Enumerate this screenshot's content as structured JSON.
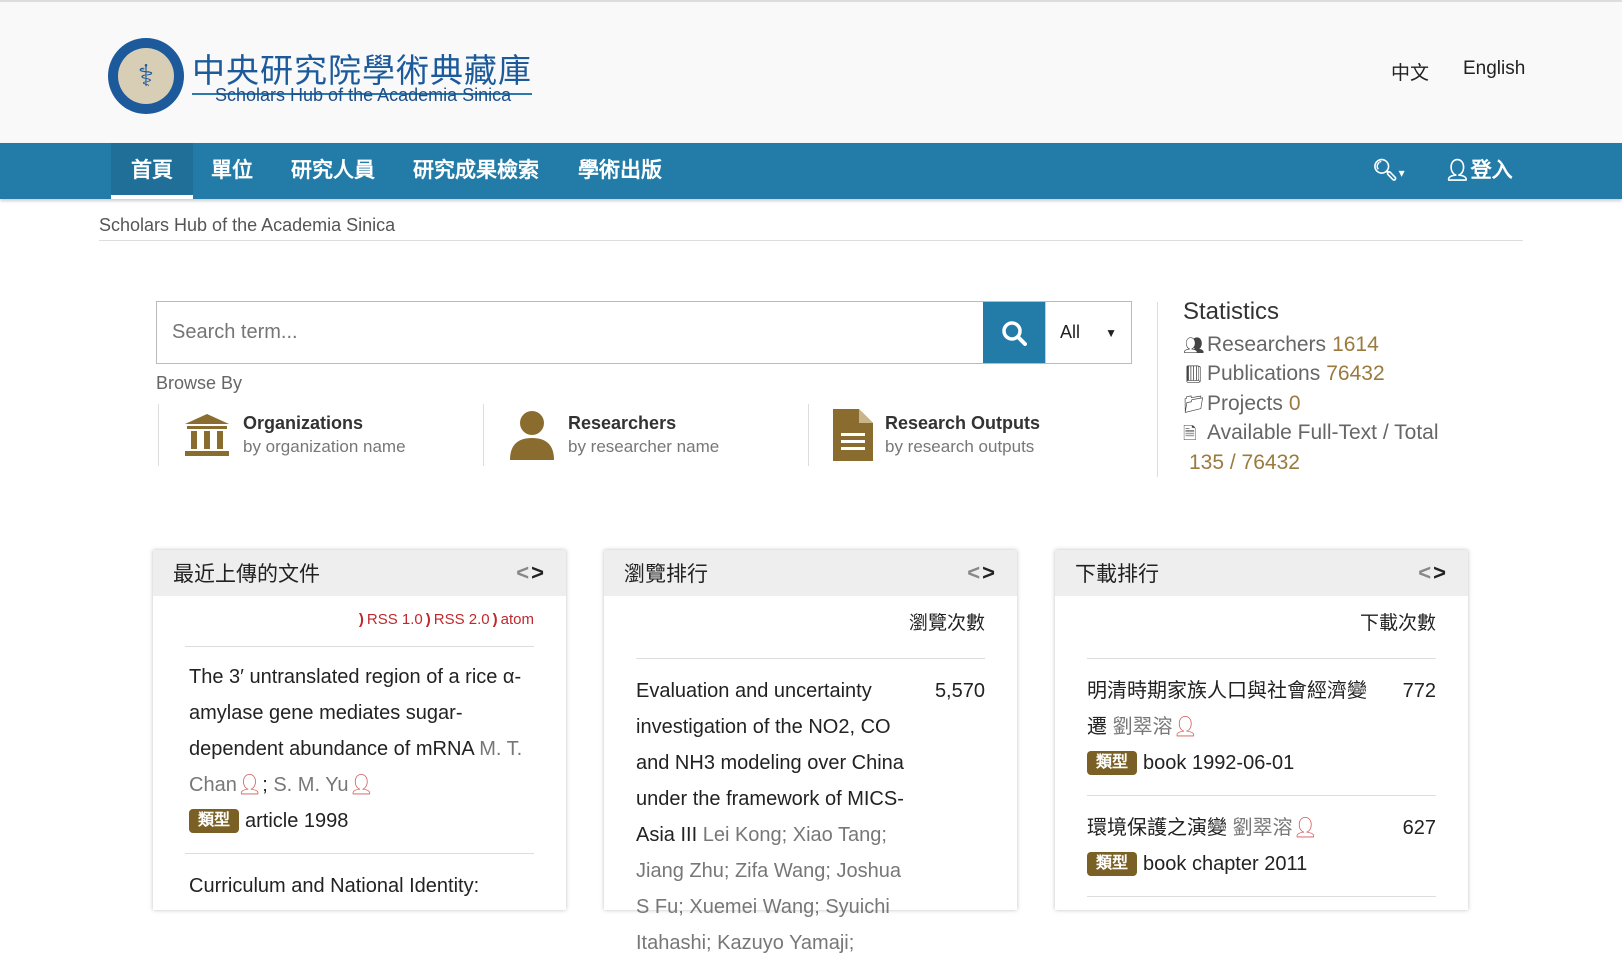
{
  "header": {
    "logo_zh": "中央研究院學術典藏庫",
    "logo_en": "Scholars Hub of the Academia Sinica",
    "lang_zh": "中文",
    "lang_en": "English"
  },
  "nav": {
    "items": [
      "首頁",
      "單位",
      "研究人員",
      "研究成果檢索",
      "學術出版"
    ],
    "login": "登入"
  },
  "breadcrumb": "Scholars Hub of the Academia Sinica",
  "search": {
    "placeholder": "Search term...",
    "scope": "All"
  },
  "browse": {
    "label": "Browse By",
    "items": [
      {
        "title": "Organizations",
        "sub": "by organization name"
      },
      {
        "title": "Researchers",
        "sub": "by researcher name"
      },
      {
        "title": "Research Outputs",
        "sub": "by research outputs"
      }
    ]
  },
  "stats": {
    "title": "Statistics",
    "researchers_label": "Researchers",
    "researchers": "1614",
    "publications_label": "Publications",
    "publications": "76432",
    "projects_label": "Projects",
    "projects": "0",
    "fulltext_label": "Available Full-Text / Total",
    "fulltext": "135 /  76432"
  },
  "panels": {
    "recent": {
      "title": "最近上傳的文件",
      "rss1": "RSS 1.0",
      "rss2": "RSS 2.0",
      "atom": "atom",
      "items": [
        {
          "title": "The 3′ untranslated region of a rice α-amylase gene mediates sugar-dependent abundance of mRNA",
          "author1": "M. T. Chan",
          "author2": "S. M. Yu",
          "tag": "類型",
          "meta": "article 1998"
        },
        {
          "title": "Curriculum and National Identity:"
        }
      ]
    },
    "views": {
      "title": "瀏覽排行",
      "col": "瀏覽次數",
      "items": [
        {
          "title": "Evaluation and uncertainty investigation of the NO2, CO and NH3 modeling over China under the framework of MICS-Asia III",
          "authors": "Lei Kong; Xiao Tang; Jiang Zhu; Zifa Wang; Joshua S Fu; Xuemei Wang; Syuichi Itahashi; Kazuyo Yamaji;",
          "count": "5,570"
        }
      ]
    },
    "downloads": {
      "title": "下載排行",
      "col": "下載次數",
      "items": [
        {
          "title": "明清時期家族人口與社會經濟變遷",
          "author": "劉翠溶",
          "tag": "類型",
          "meta": "book 1992-06-01",
          "count": "772"
        },
        {
          "title": "環境保護之演變",
          "author": "劉翠溶",
          "tag": "類型",
          "meta": "book chapter 2011",
          "count": "627"
        }
      ]
    }
  },
  "colors": {
    "nav": "#237ba8",
    "tag": "#7a6024",
    "rss": "#c0282d"
  }
}
